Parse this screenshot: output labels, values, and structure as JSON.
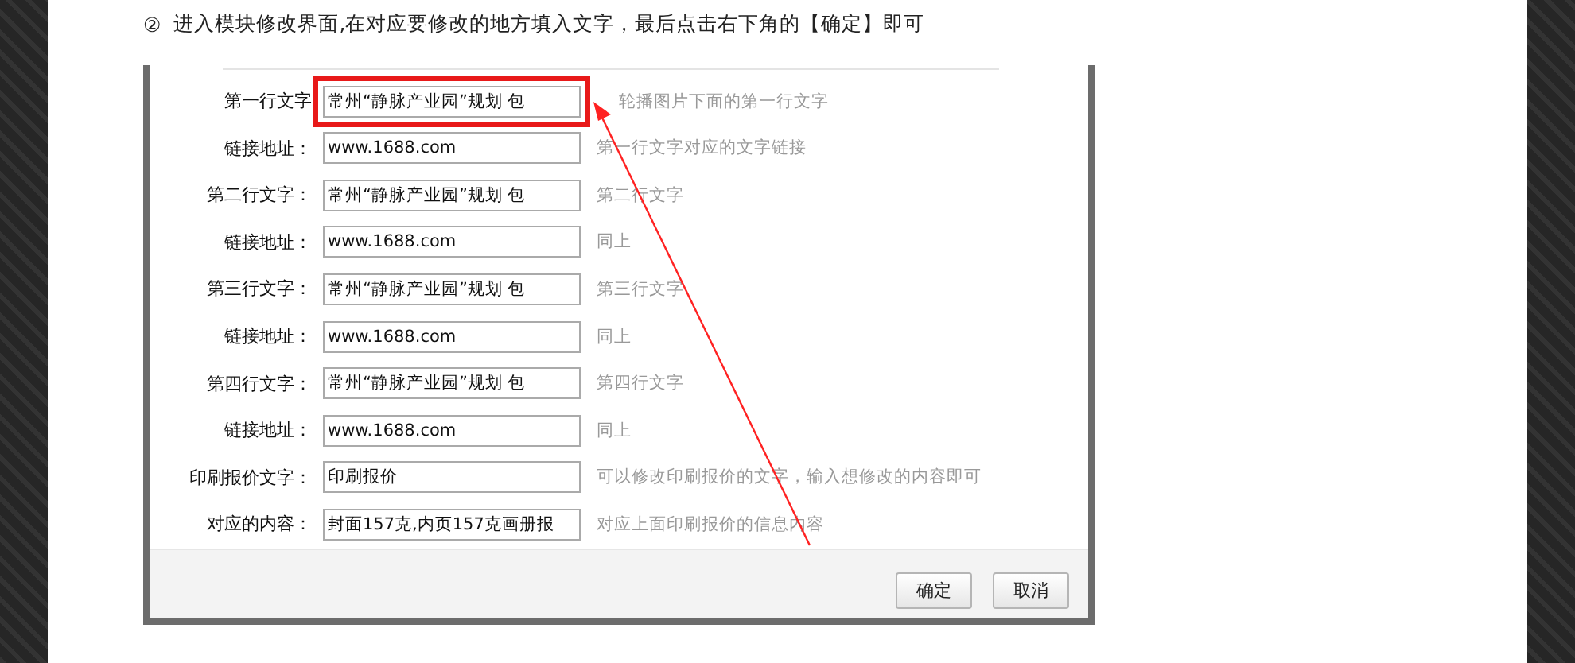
{
  "instruction": {
    "step": "②",
    "text": "进入模块修改界面,在对应要修改的地方填入文字，最后点击右下角的【确定】即可"
  },
  "form": {
    "rows": [
      {
        "label": "第一行文字",
        "value": "常州“静脉产业园”规划 包",
        "hint": "轮播图片下面的第一行文字",
        "highlighted": true
      },
      {
        "label": "链接地址：",
        "value": "www.1688.com",
        "hint": "第一行文字对应的文字链接",
        "highlighted": false
      },
      {
        "label": "第二行文字：",
        "value": "常州“静脉产业园”规划 包",
        "hint": "第二行文字",
        "highlighted": false
      },
      {
        "label": "链接地址：",
        "value": "www.1688.com",
        "hint": "同上",
        "highlighted": false
      },
      {
        "label": "第三行文字：",
        "value": "常州“静脉产业园”规划 包",
        "hint": "第三行文字",
        "highlighted": false
      },
      {
        "label": "链接地址：",
        "value": "www.1688.com",
        "hint": "同上",
        "highlighted": false
      },
      {
        "label": "第四行文字：",
        "value": "常州“静脉产业园”规划 包",
        "hint": "第四行文字",
        "highlighted": false
      },
      {
        "label": "链接地址：",
        "value": "www.1688.com",
        "hint": "同上",
        "highlighted": false
      },
      {
        "label": "印刷报价文字：",
        "value": "印刷报价",
        "hint": "可以修改印刷报价的文字，输入想修改的内容即可",
        "highlighted": false
      },
      {
        "label": "对应的内容：",
        "value": "封面157克,内页157克画册报",
        "hint": "对应上面印刷报价的信息内容",
        "highlighted": false
      }
    ]
  },
  "buttons": [
    "确定",
    "取消"
  ]
}
